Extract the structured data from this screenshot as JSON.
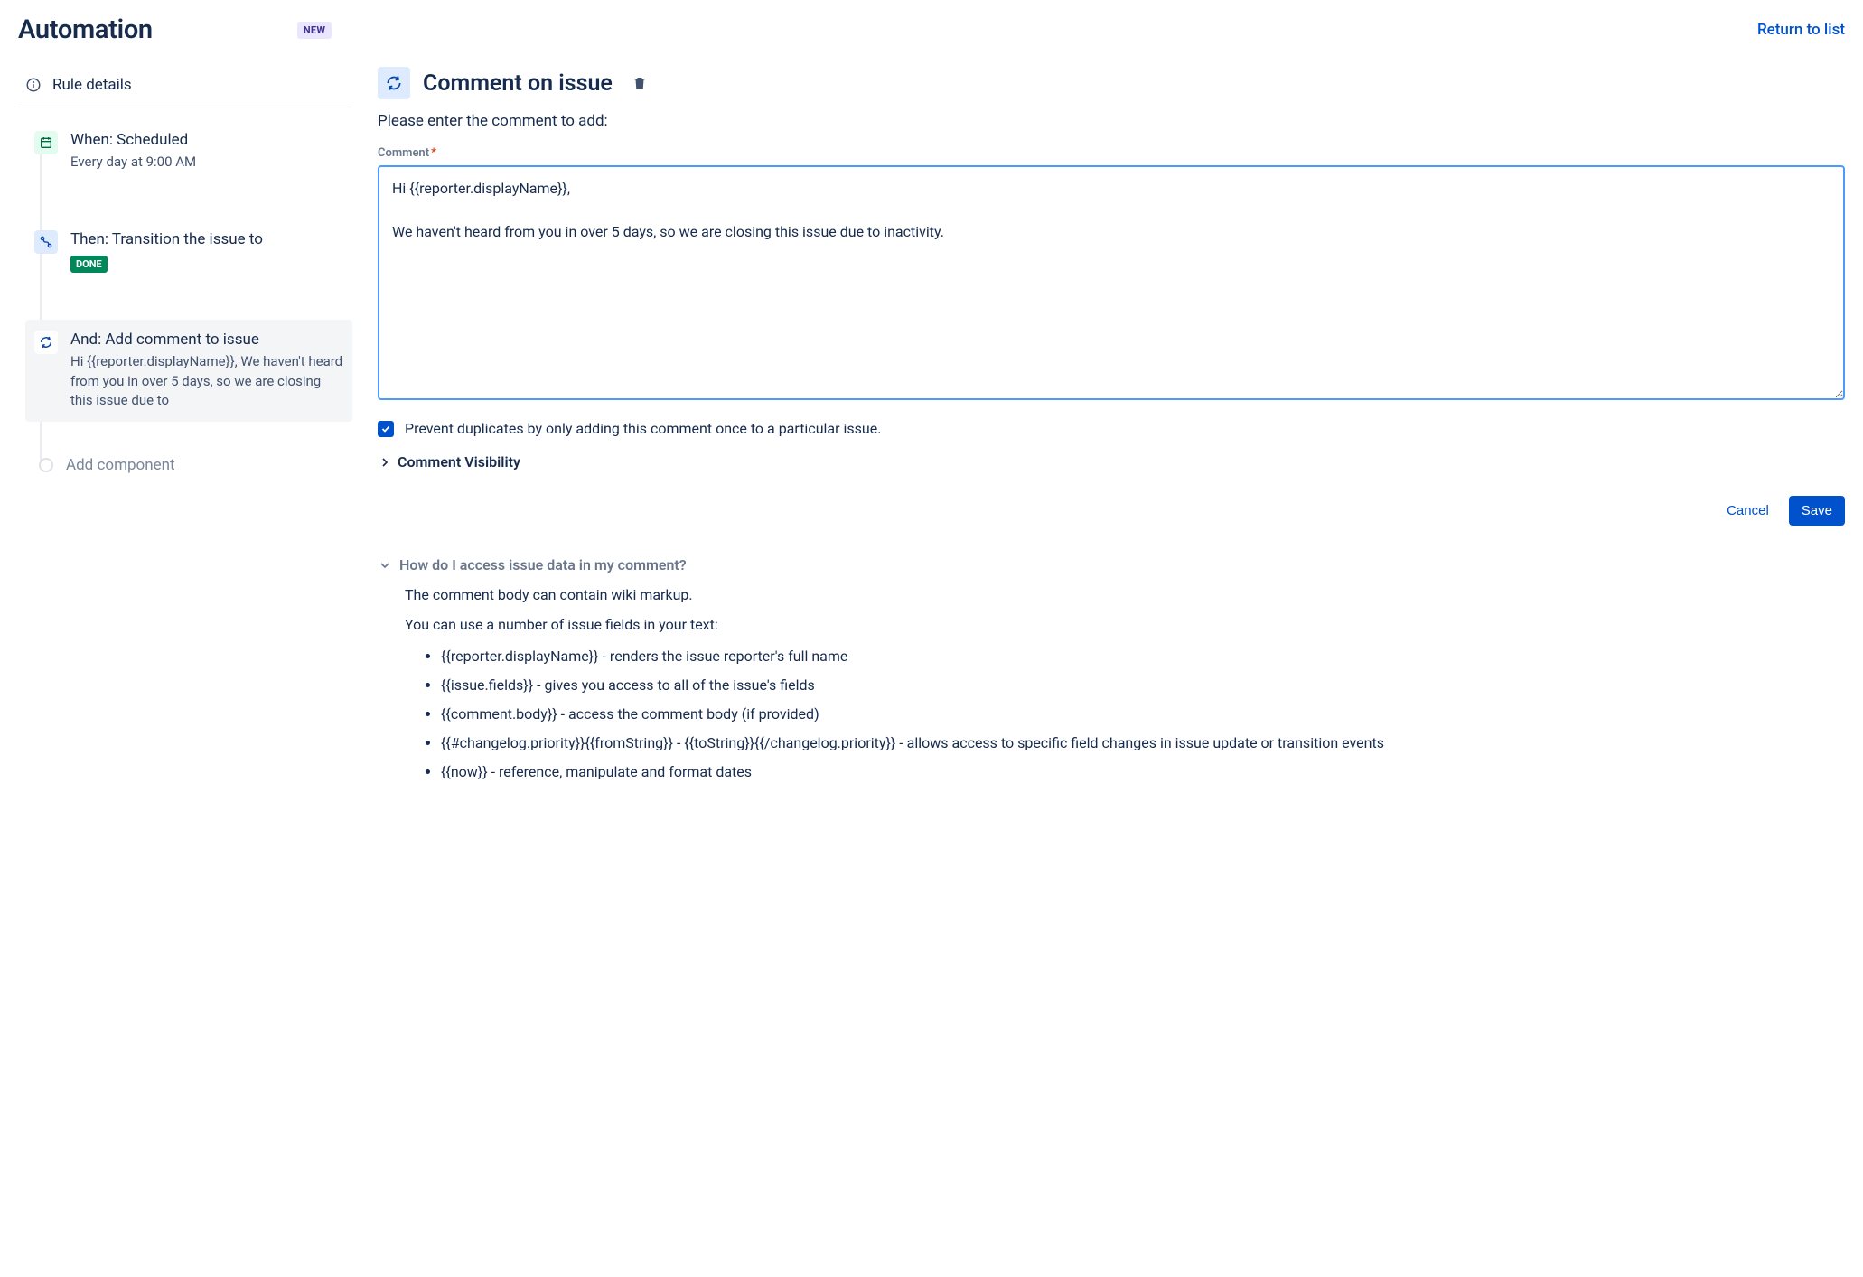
{
  "header": {
    "title": "Automation",
    "badge": "NEW",
    "return_link": "Return to list"
  },
  "sidebar": {
    "rule_details": "Rule details",
    "nodes": {
      "when": {
        "title": "When: Scheduled",
        "sub": "Every day at 9:00 AM"
      },
      "then": {
        "title": "Then: Transition the issue to",
        "lozenge": "DONE"
      },
      "and": {
        "title": "And: Add comment to issue",
        "sub": "Hi {{reporter.displayName}}, We haven't heard from you in over 5 days, so we are closing this issue due to"
      }
    },
    "add_component": "Add component"
  },
  "main": {
    "title": "Comment on issue",
    "intro": "Please enter the comment to add:",
    "comment_label": "Comment",
    "comment_value": "Hi {{reporter.displayName}},\n\nWe haven't heard from you in over 5 days, so we are closing this issue due to inactivity.",
    "prevent_dup_label": "Prevent duplicates by only adding this comment once to a particular issue.",
    "visibility_label": "Comment Visibility",
    "cancel": "Cancel",
    "save": "Save"
  },
  "help": {
    "title": "How do I access issue data in my comment?",
    "line1": "The comment body can contain wiki markup.",
    "line2": "You can use a number of issue fields in your text:",
    "items": [
      "{{reporter.displayName}} - renders the issue reporter's full name",
      "{{issue.fields}} - gives you access to all of the issue's fields",
      "{{comment.body}} - access the comment body (if provided)",
      "{{#changelog.priority}}{{fromString}} - {{toString}}{{/changelog.priority}} - allows access to specific field changes in issue update or transition events",
      "{{now}} - reference, manipulate and format dates"
    ]
  }
}
